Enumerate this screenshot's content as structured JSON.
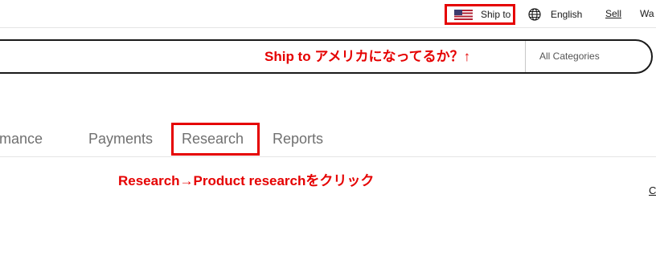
{
  "header": {
    "ship_to_label": "Ship to",
    "flag_icon": "us-flag-icon",
    "language_label": "English",
    "language_icon": "globe-icon",
    "sell_label": "Sell",
    "watchlist_label": "Wa"
  },
  "search": {
    "value": "",
    "placeholder": "",
    "category_selected": "All Categories"
  },
  "annotations": {
    "ship_to_note": "Ship to アメリカになってるか？↑",
    "research_note": "Research→Product researchをクリック"
  },
  "tabs": [
    {
      "label": "formance"
    },
    {
      "label": "Payments"
    },
    {
      "label": "Research"
    },
    {
      "label": "Reports"
    }
  ],
  "edge_link_label": "C",
  "colors": {
    "annotation_red": "#e50000",
    "tab_text": "#707070",
    "text_primary": "#191919"
  }
}
